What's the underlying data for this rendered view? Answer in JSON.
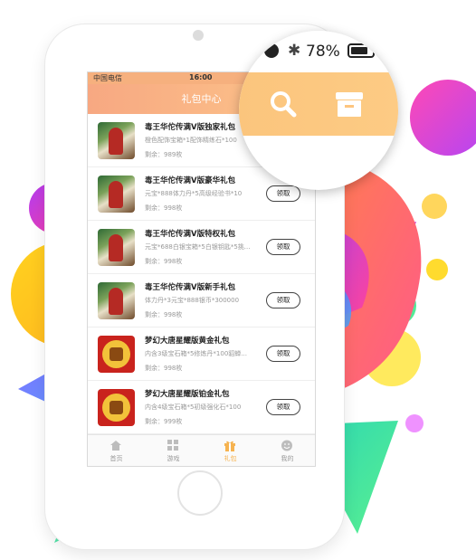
{
  "status_bar": {
    "carrier": "中国电信",
    "time": "16:00"
  },
  "header": {
    "title": "礼包中心"
  },
  "magnifier": {
    "battery_text": "78%",
    "search_icon": "search-icon",
    "box_icon": "gift-box-icon"
  },
  "gifts": [
    {
      "name": "毒王华佗传满V版独家礼包",
      "desc": "橙色配饰宝箱*1配饰精练石*100",
      "remain": "剩余：989枚",
      "button": "",
      "thumb": "hua"
    },
    {
      "name": "毒王华佗传满V版豪华礼包",
      "desc": "元宝*888体力丹*5高级经验书*10",
      "remain": "剩余：998枚",
      "button": "领取",
      "thumb": "hua"
    },
    {
      "name": "毒王华佗传满V版特权礼包",
      "desc": "元宝*688白银宝箱*5白银钥匙*5挑...",
      "remain": "剩余：998枚",
      "button": "领取",
      "thumb": "hua"
    },
    {
      "name": "毒王华佗传满V版新手礼包",
      "desc": "体力丹*3元宝*888银币*300000",
      "remain": "剩余：998枚",
      "button": "领取",
      "thumb": "hua"
    },
    {
      "name": "梦幻大唐星耀版黄金礼包",
      "desc": "内含3级宝石箱*5修炼丹*100貂蝉...",
      "remain": "剩余：998枚",
      "button": "领取",
      "thumb": "meng"
    },
    {
      "name": "梦幻大唐星耀版铂金礼包",
      "desc": "内含4级宝石箱*5初级强化石*100",
      "remain": "剩余：999枚",
      "button": "领取",
      "thumb": "meng"
    }
  ],
  "tabbar": {
    "items": [
      {
        "label": "首页",
        "icon": "home-icon"
      },
      {
        "label": "游戏",
        "icon": "grid-icon"
      },
      {
        "label": "礼包",
        "icon": "gift-icon"
      },
      {
        "label": "我的",
        "icon": "smile-icon"
      }
    ],
    "active_color": "#f6b350"
  },
  "colors": {
    "header_start": "#f7a882",
    "header_end": "#fdc58a"
  }
}
